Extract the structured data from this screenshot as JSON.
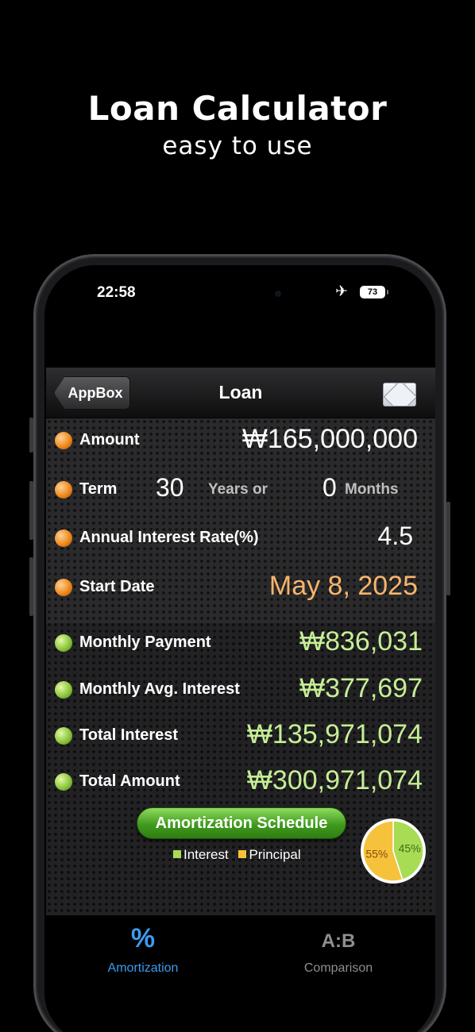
{
  "promo": {
    "title": "Loan Calculator",
    "subtitle": "easy to use"
  },
  "status_bar": {
    "time": "22:58",
    "battery": "73",
    "airplane_mode": true
  },
  "navbar": {
    "back_label": "AppBox",
    "title": "Loan",
    "action_icon": "mail-icon"
  },
  "inputs": {
    "amount": {
      "label": "Amount",
      "value": "₩165,000,000"
    },
    "term": {
      "label": "Term",
      "years": "30",
      "years_unit": "Years or",
      "months": "0",
      "months_unit": "Months"
    },
    "rate": {
      "label": "Annual Interest Rate(%)",
      "value": "4.5"
    },
    "start_date": {
      "label": "Start Date",
      "value": "May 8, 2025"
    }
  },
  "results": {
    "monthly_payment": {
      "label": "Monthly Payment",
      "value": "₩836,031"
    },
    "monthly_avg_interest": {
      "label": "Monthly Avg. Interest",
      "value": "₩377,697"
    },
    "total_interest": {
      "label": "Total Interest",
      "value": "₩135,971,074"
    },
    "total_amount": {
      "label": "Total Amount",
      "value": "₩300,971,074"
    }
  },
  "amortization_button": "Amortization Schedule",
  "legend": {
    "interest": "Interest",
    "principal": "Principal"
  },
  "chart_data": {
    "type": "pie",
    "slices": [
      {
        "name": "Interest",
        "value": 45,
        "label": "45%",
        "color": "#a8dc55"
      },
      {
        "name": "Principal",
        "value": 55,
        "label": "55%",
        "color": "#f6c23c"
      }
    ]
  },
  "colors": {
    "accent_tab": "#3e9bf0",
    "result_text": "#c6ee95",
    "date_text": "#f6b56b"
  },
  "tabs": [
    {
      "icon_glyph": "%",
      "icon": "percent-icon",
      "label": "Amortization",
      "active": true
    },
    {
      "icon_glyph": "A:B",
      "icon": "comparison-icon",
      "label": "Comparison",
      "active": false
    }
  ]
}
